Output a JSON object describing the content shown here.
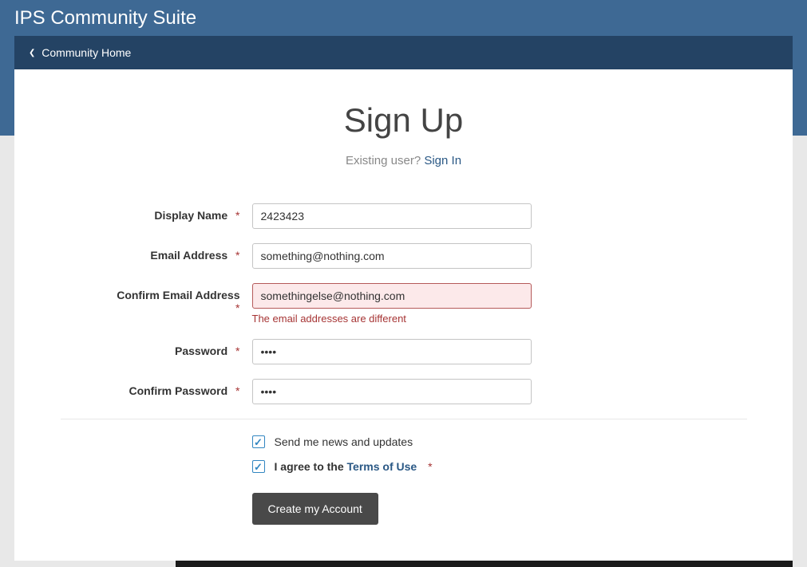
{
  "site": {
    "title": "IPS Community Suite"
  },
  "breadcrumb": {
    "home": "Community Home"
  },
  "page": {
    "title": "Sign Up",
    "existing_prefix": "Existing user? ",
    "signin_link": "Sign In"
  },
  "form": {
    "display_name": {
      "label": "Display Name",
      "value": "2423423"
    },
    "email": {
      "label": "Email Address",
      "value": "something@nothing.com"
    },
    "confirm_email": {
      "label": "Confirm Email Address",
      "value": "somethingelse@nothing.com",
      "error": "The email addresses are different"
    },
    "password": {
      "label": "Password",
      "value": "••••"
    },
    "confirm_password": {
      "label": "Confirm Password",
      "value": "••••"
    },
    "newsletter": {
      "label": "Send me news and updates",
      "checked": true
    },
    "terms": {
      "prefix": "I agree to the ",
      "link": "Terms of Use",
      "checked": true
    },
    "submit": "Create my Account",
    "required_marker": "*"
  }
}
